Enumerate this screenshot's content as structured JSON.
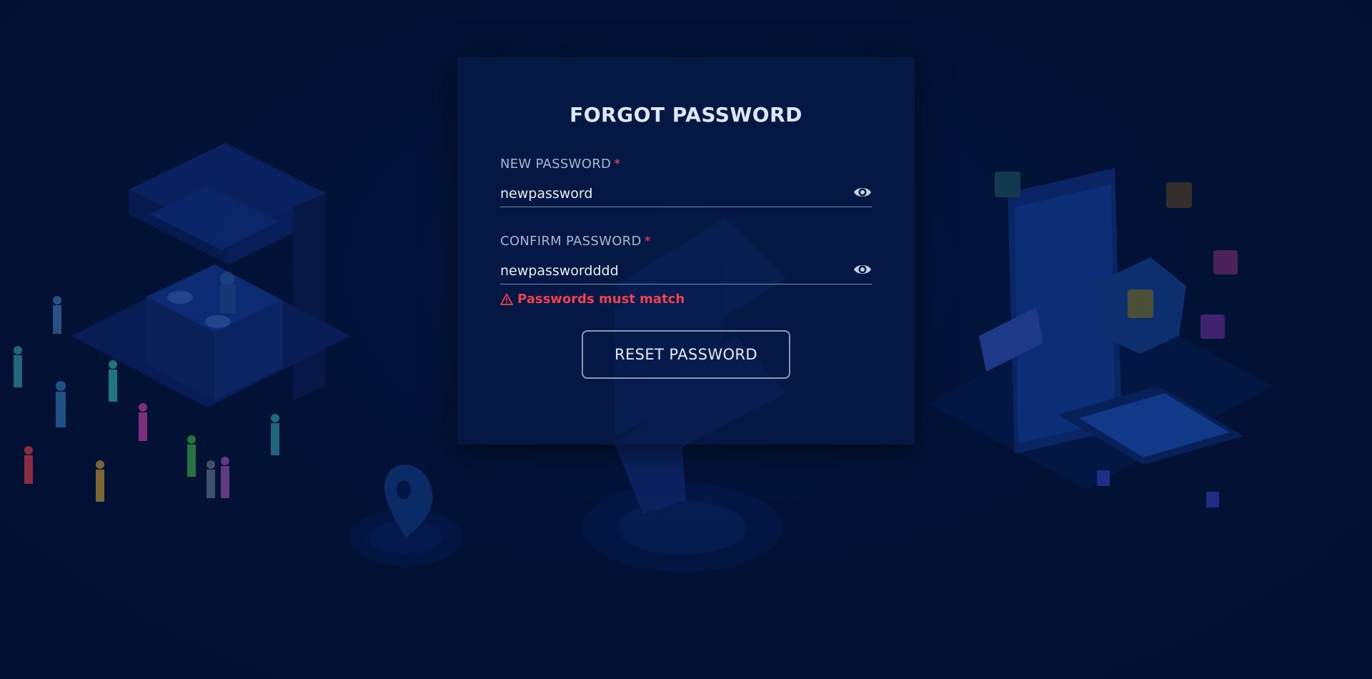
{
  "page": {
    "title": "FORGOT PASSWORD"
  },
  "fields": {
    "new_password": {
      "label": "NEW PASSWORD",
      "required_mark": "*",
      "value": "newpassword",
      "icon": "eye-icon"
    },
    "confirm_password": {
      "label": "CONFIRM PASSWORD",
      "required_mark": "*",
      "value": "newpasswordddd",
      "icon": "eye-icon",
      "error": "Passwords must match",
      "error_icon": "warning-icon"
    }
  },
  "actions": {
    "reset_label": "RESET PASSWORD"
  },
  "colors": {
    "background": "#011030",
    "card": "#061a46",
    "title": "#dfe6ff",
    "label": "#aab6d6",
    "required": "#e84a5a",
    "error": "#f0414f",
    "button_border": "#8e97b3"
  }
}
